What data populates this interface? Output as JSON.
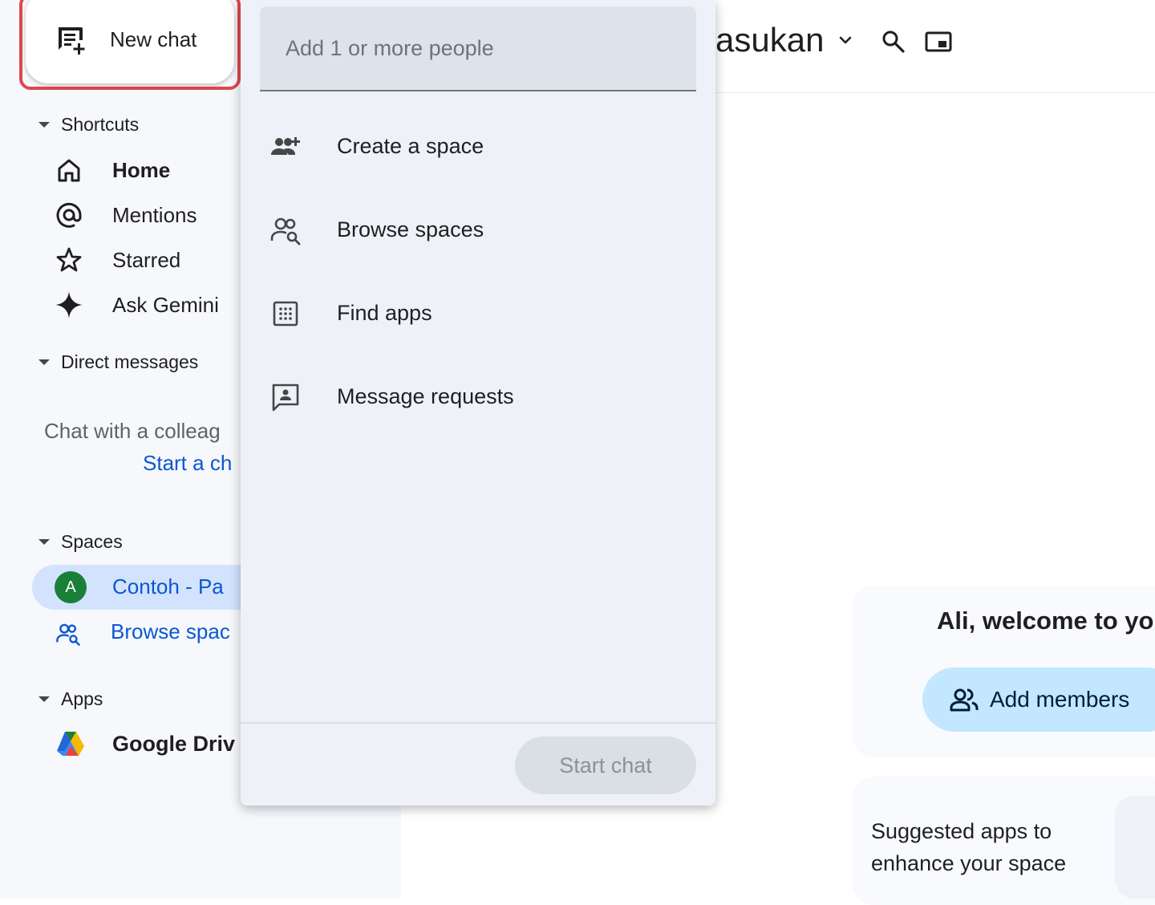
{
  "sidebar": {
    "new_chat_label": "New chat",
    "shortcuts": {
      "header": "Shortcuts",
      "items": [
        {
          "label": "Home"
        },
        {
          "label": "Mentions"
        },
        {
          "label": "Starred"
        },
        {
          "label": "Ask Gemini"
        }
      ]
    },
    "direct_messages": {
      "header": "Direct messages",
      "empty_text": "Chat with a colleag",
      "start_link": "Start a ch"
    },
    "spaces": {
      "header": "Spaces",
      "active_space": {
        "avatar_letter": "A",
        "name": "Contoh - Pa"
      },
      "browse_label": "Browse spac"
    },
    "apps": {
      "header": "Apps",
      "items": [
        {
          "label": "Google Driv"
        }
      ]
    }
  },
  "header": {
    "title": "asukan"
  },
  "dropdown": {
    "input_placeholder": "Add 1 or more people",
    "items": [
      {
        "label": "Create a space"
      },
      {
        "label": "Browse spaces"
      },
      {
        "label": "Find apps"
      },
      {
        "label": "Message requests"
      }
    ],
    "start_chat_label": "Start chat"
  },
  "main": {
    "welcome_text": "Ali, welcome to yo",
    "add_members_label": "Add members",
    "suggested_text": "Suggested apps to enhance your space"
  },
  "colors": {
    "highlight": "#e0474f",
    "link_blue": "#0b57d0",
    "active_space_bg": "#d3e3fd",
    "avatar_green": "#188038",
    "add_members_bg": "#c2e7ff"
  }
}
